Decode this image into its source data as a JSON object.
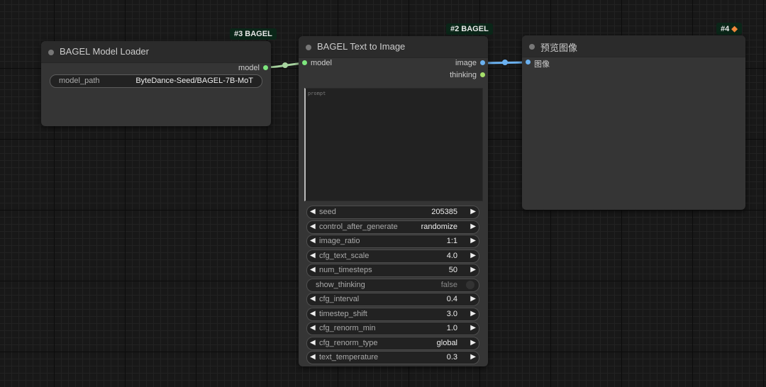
{
  "nodes": {
    "loader": {
      "badge": "#3 BAGEL",
      "title": "BAGEL Model Loader",
      "output": "model",
      "widget": {
        "label": "model_path",
        "value": "ByteDance-Seed/BAGEL-7B-MoT"
      }
    },
    "t2i": {
      "badge": "#2 BAGEL",
      "title": "BAGEL Text to Image",
      "input": "model",
      "outputs": [
        "image",
        "thinking"
      ],
      "prompt_placeholder": "prompt",
      "widgets": [
        {
          "label": "seed",
          "value": "205385",
          "type": "number"
        },
        {
          "label": "control_after_generate",
          "value": "randomize",
          "type": "combo"
        },
        {
          "label": "image_ratio",
          "value": "1:1",
          "type": "combo"
        },
        {
          "label": "cfg_text_scale",
          "value": "4.0",
          "type": "number"
        },
        {
          "label": "num_timesteps",
          "value": "50",
          "type": "number"
        },
        {
          "label": "show_thinking",
          "value": "false",
          "type": "toggle"
        },
        {
          "label": "cfg_interval",
          "value": "0.4",
          "type": "number"
        },
        {
          "label": "timestep_shift",
          "value": "3.0",
          "type": "number"
        },
        {
          "label": "cfg_renorm_min",
          "value": "1.0",
          "type": "number"
        },
        {
          "label": "cfg_renorm_type",
          "value": "global",
          "type": "combo"
        },
        {
          "label": "text_temperature",
          "value": "0.3",
          "type": "number"
        }
      ]
    },
    "preview": {
      "badge": "#4",
      "badge_icon": "fox-icon",
      "title": "预览图像",
      "input": "图像"
    }
  },
  "colors": {
    "model_link": "#a8d4a0",
    "image_link": "#6bb1f0",
    "badge_bg": "#0a2618"
  }
}
